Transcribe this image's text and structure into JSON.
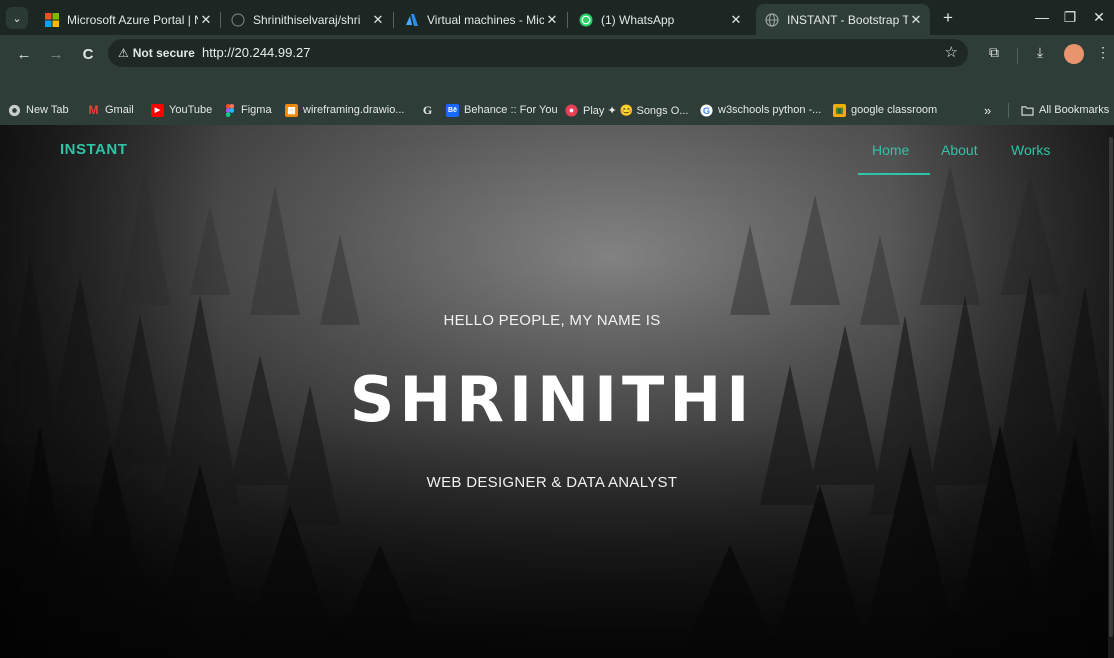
{
  "browser": {
    "tabs": [
      {
        "title": "Microsoft Azure Portal | N",
        "favicon": "microsoft-logo"
      },
      {
        "title": "Shrinithiselvaraj/shri",
        "favicon": "github-icon"
      },
      {
        "title": "Virtual machines - Micros",
        "favicon": "azure-icon"
      },
      {
        "title": "(1) WhatsApp",
        "favicon": "whatsapp-icon"
      },
      {
        "title": "INSTANT - Bootstrap The",
        "favicon": "globe-icon",
        "active": true
      }
    ],
    "close_glyph": "✕",
    "new_tab_glyph": "+",
    "menu_glyph": "⌄",
    "window": {
      "minimize": "—",
      "restore": "❐",
      "close": "✕"
    },
    "toolbar": {
      "back": "←",
      "forward": "→",
      "reload": "C",
      "security_icon": "⚠",
      "security_label": "Not secure",
      "url": "http://20.244.99.27",
      "star": "☆",
      "extensions": "⧉",
      "download": "⤓",
      "more": "⋮"
    },
    "bookmarks": [
      {
        "label": "New Tab",
        "icon": "globe-icon",
        "color": "#c6cdcb"
      },
      {
        "label": "Gmail",
        "icon": "gmail-icon",
        "color": "#ea4335"
      },
      {
        "label": "YouTube",
        "icon": "youtube-icon",
        "color": "#ff0000"
      },
      {
        "label": "Figma",
        "icon": "figma-icon",
        "color": "#f24e1e"
      },
      {
        "label": "wireframing.drawio...",
        "icon": "drawio-icon",
        "color": "#f08705"
      },
      {
        "label": "",
        "icon": "g-icon",
        "color": "#4c8bf5"
      },
      {
        "label": "Behance :: For You",
        "icon": "behance-icon",
        "color": "#1769ff"
      },
      {
        "label": "Play ✦ 😊 Songs O...",
        "icon": "music-icon",
        "color": "#e94057"
      },
      {
        "label": "w3schools python -...",
        "icon": "google-icon",
        "color": "#4285f4"
      },
      {
        "label": "google classroom",
        "icon": "classroom-icon",
        "color": "#f9ab00"
      }
    ],
    "bookmarks_overflow": "»",
    "all_bookmarks": "All Bookmarks"
  },
  "site": {
    "brand": "INSTANT",
    "nav": [
      "Home",
      "About",
      "Works"
    ],
    "accent": "#2ec4a6",
    "hero": {
      "greeting": "HELLO PEOPLE, MY NAME IS",
      "name": "SHRINITHI",
      "role": "WEB DESIGNER & DATA ANALYST"
    }
  }
}
